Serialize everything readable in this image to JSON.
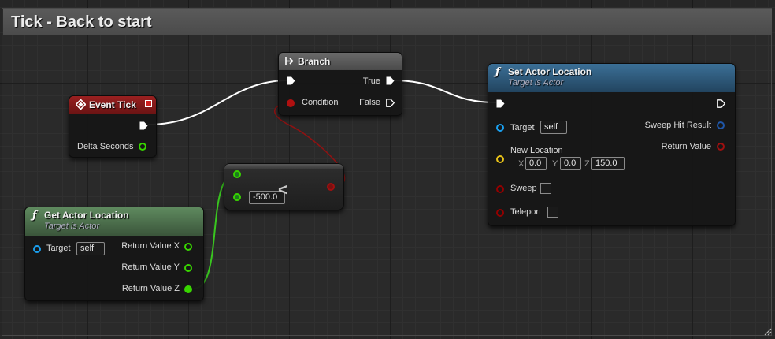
{
  "comment": {
    "title": "Tick - Back to start"
  },
  "nodes": {
    "event_tick": {
      "title": "Event Tick",
      "out_delta": "Delta Seconds"
    },
    "branch": {
      "title": "Branch",
      "in_condition": "Condition",
      "out_true": "True",
      "out_false": "False"
    },
    "set_actor_location": {
      "title": "Set Actor Location",
      "subtitle": "Target is Actor",
      "target_label": "Target",
      "target_value": "self",
      "new_location_label": "New Location",
      "x_label": "X",
      "x_value": "0.0",
      "y_label": "Y",
      "y_value": "0.0",
      "z_label": "Z",
      "z_value": "150.0",
      "sweep_label": "Sweep",
      "teleport_label": "Teleport",
      "sweep_hit_result": "Sweep Hit Result",
      "return_value": "Return Value"
    },
    "get_actor_location": {
      "title": "Get Actor Location",
      "subtitle": "Target is Actor",
      "target_label": "Target",
      "target_value": "self",
      "return_x": "Return Value X",
      "return_y": "Return Value Y",
      "return_z": "Return Value Z"
    },
    "less_than": {
      "operator": "<",
      "b_value": "-500.0"
    }
  },
  "colors": {
    "exec": "#ffffff",
    "float": "#38d500",
    "bool": "#930000",
    "object": "#0099e6",
    "vector": "#e8c218",
    "struct": "#1f56a8",
    "event_header": "#8a1a1a",
    "function_header": "#2f5f83",
    "pure_header": "#4a6f4a",
    "macro_header": "#555555"
  }
}
